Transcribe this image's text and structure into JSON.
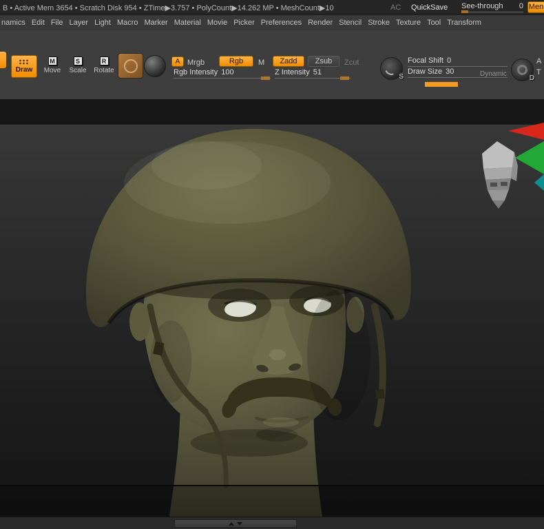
{
  "status_bar": {
    "stats_text": "B • Active Mem 3654 • Scratch Disk 954 • ZTime▶3.757 • PolyCount▶14.262 MP • MeshCount▶10",
    "ac_label": "AC",
    "quicksave_label": "QuickSave",
    "see_through_label": "See-through",
    "see_through_value": "0",
    "menus_button_label": "Men"
  },
  "menu_bar": {
    "items": [
      "namics",
      "Edit",
      "File",
      "Layer",
      "Light",
      "Macro",
      "Marker",
      "Material",
      "Movie",
      "Picker",
      "Preferences",
      "Render",
      "Stencil",
      "Stroke",
      "Texture",
      "Tool",
      "Transform"
    ]
  },
  "toolbar": {
    "draw": {
      "label": "Draw"
    },
    "move": {
      "label": "Move",
      "key": "M"
    },
    "scale": {
      "label": "Scale",
      "key": "S"
    },
    "rotate": {
      "label": "Rotate",
      "key": "R"
    },
    "color_mode": {
      "a": "A",
      "mrgb": "Mrgb",
      "rgb": "Rgb",
      "m": "M"
    },
    "rgb_intensity": {
      "label": "Rgb Intensity",
      "value": "100"
    },
    "sculpt_mode": {
      "zadd": "Zadd",
      "zsub": "Zsub",
      "zcut": "Zcut"
    },
    "z_intensity": {
      "label": "Z Intensity",
      "value": "51"
    },
    "stroke_badge": "S",
    "focal_shift": {
      "label": "Focal Shift",
      "value": "0"
    },
    "draw_size": {
      "label": "Draw Size",
      "value": "30"
    },
    "dynamic_label": "Dynamic",
    "right_circle_badge": "D",
    "edge_partial": {
      "a": "A",
      "t": "T"
    }
  },
  "colors": {
    "accent_orange": "#f59a23",
    "helmet_olive": "#57543a",
    "skin_olive": "#6b694a",
    "eye_white": "#dcddd1",
    "canvas_top": "#383838",
    "canvas_bottom": "#141414"
  }
}
